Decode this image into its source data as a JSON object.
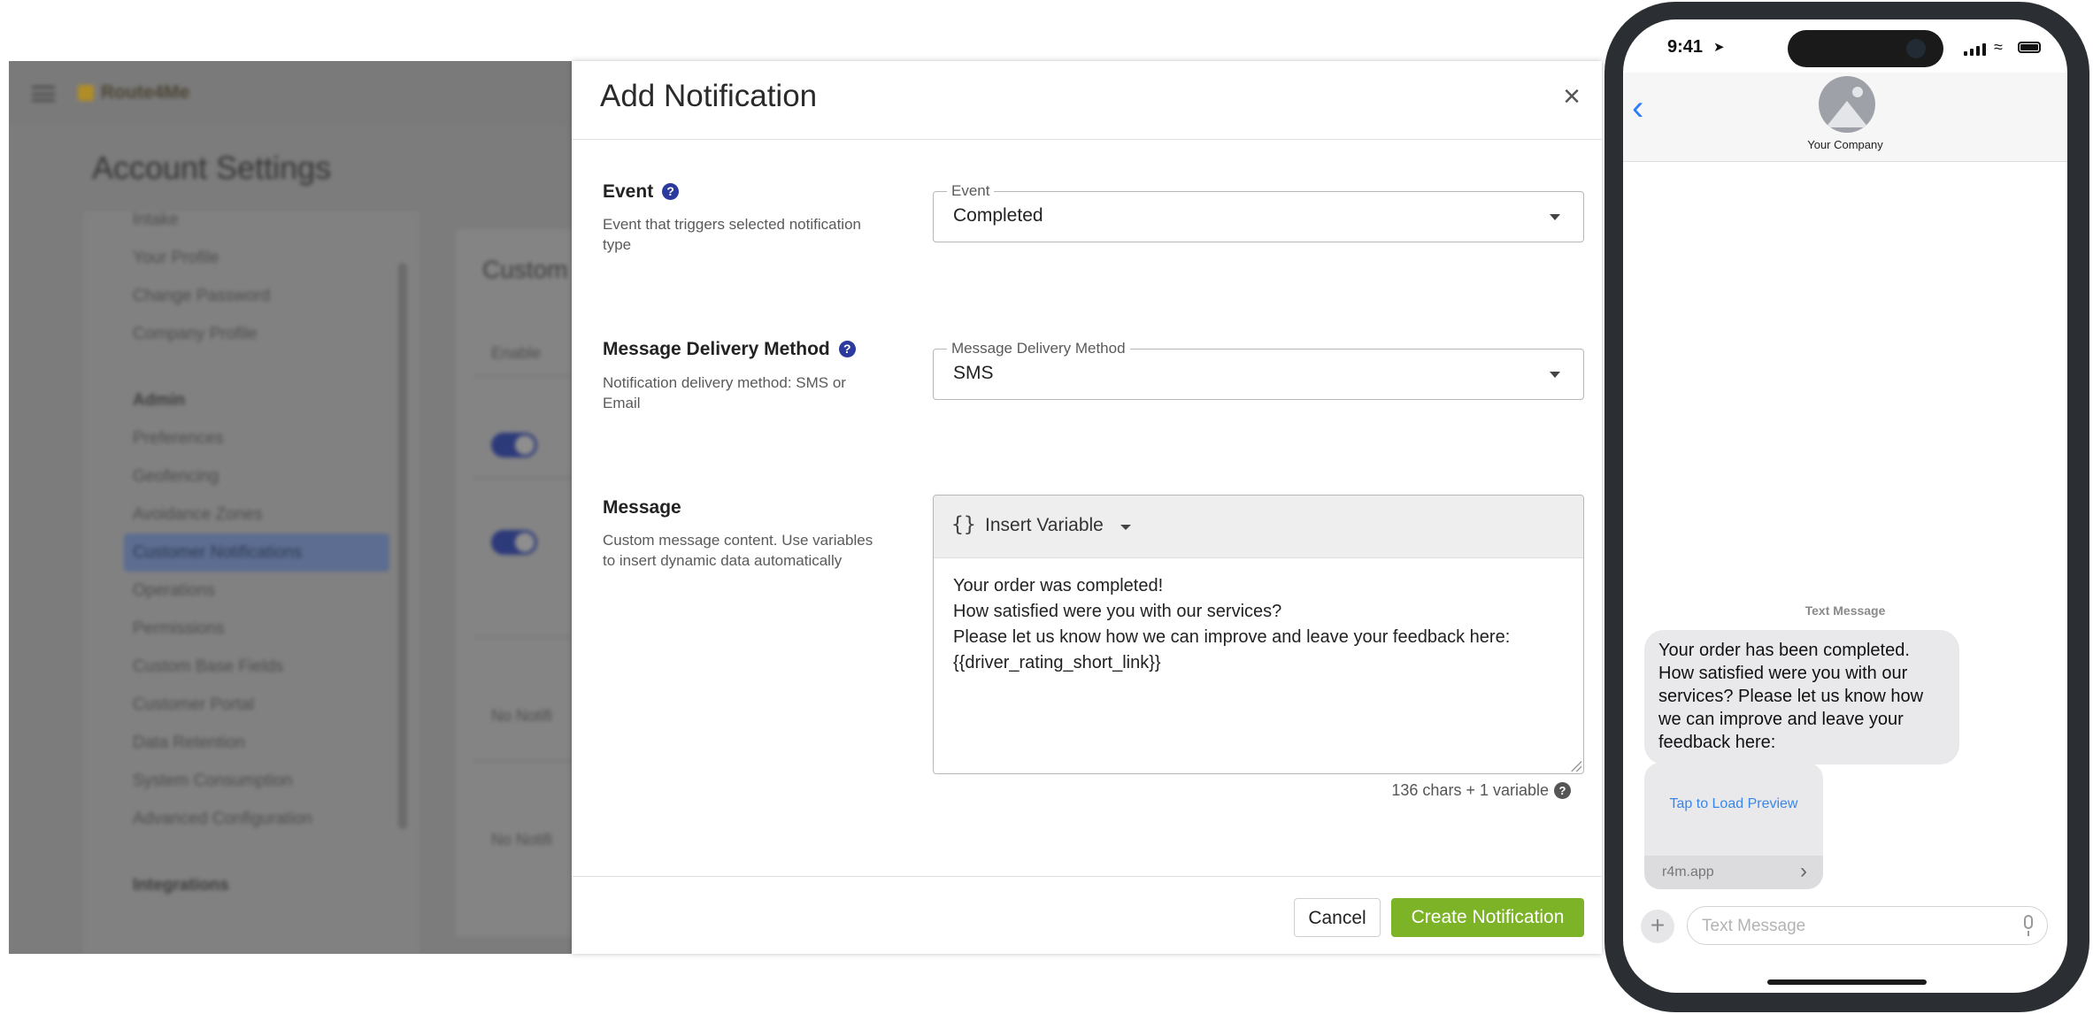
{
  "background": {
    "logo_text": "Route4Me",
    "page_title": "Account Settings",
    "menu": [
      {
        "label": "Intake",
        "kind": "item"
      },
      {
        "label": "Your Profile",
        "kind": "item"
      },
      {
        "label": "Change Password",
        "kind": "item"
      },
      {
        "label": "Company Profile",
        "kind": "item"
      },
      {
        "label": "Admin",
        "kind": "section"
      },
      {
        "label": "Preferences",
        "kind": "item"
      },
      {
        "label": "Geofencing",
        "kind": "item"
      },
      {
        "label": "Avoidance Zones",
        "kind": "item"
      },
      {
        "label": "Customer Notifications",
        "kind": "active"
      },
      {
        "label": "Operations",
        "kind": "item"
      },
      {
        "label": "Permissions",
        "kind": "item"
      },
      {
        "label": "Custom Base Fields",
        "kind": "item"
      },
      {
        "label": "Customer Portal",
        "kind": "item"
      },
      {
        "label": "Data Retention",
        "kind": "item"
      },
      {
        "label": "System Consumption",
        "kind": "item"
      },
      {
        "label": "Advanced Configuration",
        "kind": "item"
      },
      {
        "label": "Integrations",
        "kind": "section"
      }
    ],
    "content_title": "Custom",
    "table_header": "Enable",
    "rows": [
      "No Notifi",
      "No Notifi"
    ]
  },
  "modal": {
    "title": "Add Notification",
    "close_glyph": "×",
    "event": {
      "label": "Event",
      "help_glyph": "?",
      "description": "Event that triggers selected notification type",
      "field_label": "Event",
      "value": "Completed"
    },
    "delivery": {
      "label": "Message Delivery Method",
      "help_glyph": "?",
      "description": "Notification delivery method: SMS or Email",
      "field_label": "Message Delivery Method",
      "value": "SMS"
    },
    "message": {
      "label": "Message",
      "description": "Custom message content. Use variables to insert dynamic data automatically",
      "insert_braces": "{}",
      "insert_label": "Insert Variable",
      "text": "Your order was completed!\nHow satisfied were you with our services?\nPlease let us know how we can improve and leave your feedback here:\n{{driver_rating_short_link}}",
      "char_count": "136 chars + 1 variable",
      "help_glyph": "?"
    },
    "cancel_label": "Cancel",
    "create_label": "Create Notification"
  },
  "phone": {
    "time": "9:41",
    "location_glyph": "➤",
    "back_glyph": "‹",
    "contact_name": "Your Company",
    "message_label": "Text Message",
    "bubble_text": "Your order has been completed. How satisfied were you with our services? Please let us know how we can improve and leave your feedback here:",
    "preview_tap": "Tap to Load Preview",
    "preview_domain": "r4m.app",
    "preview_chevron": "›",
    "plus_glyph": "+",
    "input_placeholder": "Text Message"
  },
  "colors": {
    "accent_blue": "#2b3a9c",
    "create_green": "#7cb327",
    "ios_blue": "#2f7cf6",
    "overlay_gray": "#7c7c7c"
  }
}
